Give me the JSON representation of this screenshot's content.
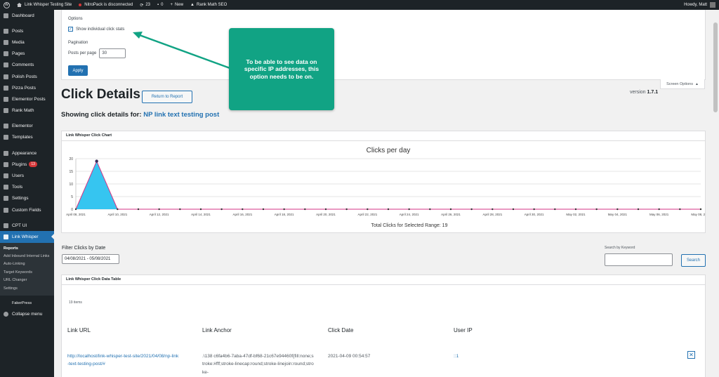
{
  "adminbar": {
    "site_name": "Link Whisper Testing Site",
    "nitropack": "NitroPack is disconnected",
    "updates": "23",
    "comments": "0",
    "new_label": "New",
    "rankmath": "Rank Math SEO",
    "howdy": "Howdy, Matt"
  },
  "sidebar": {
    "items": [
      {
        "label": "Dashboard",
        "icon": "dashboard-icon"
      },
      {
        "label": "Posts",
        "icon": "pin-icon"
      },
      {
        "label": "Media",
        "icon": "media-icon"
      },
      {
        "label": "Pages",
        "icon": "page-icon"
      },
      {
        "label": "Comments",
        "icon": "comment-icon"
      },
      {
        "label": "Polish Posts",
        "icon": "pin-icon"
      },
      {
        "label": "Pizza Posts",
        "icon": "pin-icon"
      },
      {
        "label": "Elementor Posts",
        "icon": "pin-icon"
      },
      {
        "label": "Rank Math",
        "icon": "chart-icon"
      },
      {
        "label": "Elementor",
        "icon": "elementor-icon"
      },
      {
        "label": "Templates",
        "icon": "folder-icon"
      },
      {
        "label": "Appearance",
        "icon": "brush-icon"
      },
      {
        "label": "Plugins",
        "icon": "plugin-icon",
        "badge": "13"
      },
      {
        "label": "Users",
        "icon": "user-icon"
      },
      {
        "label": "Tools",
        "icon": "wrench-icon"
      },
      {
        "label": "Settings",
        "icon": "settings-icon"
      },
      {
        "label": "Custom Fields",
        "icon": "grid-icon"
      },
      {
        "label": "CPT UI",
        "icon": "cpt-icon"
      },
      {
        "label": "Link Whisper",
        "icon": "link-icon"
      }
    ],
    "submenu": [
      "Reports",
      "Add Inbound Internal Links",
      "Auto-Linking",
      "Target Keywords",
      "URL Changer",
      "Settings"
    ],
    "faker": "FakerPress",
    "collapse": "Collapse menu"
  },
  "screen_options": {
    "options_heading": "Options",
    "checkbox_label": "Show individual click stats",
    "pagination_heading": "Pagination",
    "per_page_label": "Posts per page",
    "per_page_value": "30",
    "apply": "Apply",
    "tab_label": "Screen Options"
  },
  "header": {
    "title": "Click Details",
    "return_button": "Return to Report",
    "version_label": "version",
    "version": "1.7.1",
    "showing_label": "Showing click details for:",
    "post_title": "NP link text testing post"
  },
  "annotation": {
    "text": "To be able to see data on specific IP addresses, this option needs to be on."
  },
  "chart_box": {
    "title": "Link Whisper Click Chart"
  },
  "chart_data": {
    "type": "area",
    "title": "Clicks per day",
    "xlabel": "",
    "ylabel": "",
    "ylim": [
      0,
      20
    ],
    "yticks": [
      0,
      5,
      10,
      15,
      20
    ],
    "grid": true,
    "legend": "none",
    "tick_labels": [
      "April 08, 2021",
      "April 10, 2021",
      "April 12, 2021",
      "April 14, 2021",
      "April 16, 2021",
      "April 18, 2021",
      "April 20, 2021",
      "April 22, 2021",
      "April 24, 2021",
      "April 26, 2021",
      "April 28, 2021",
      "April 30, 2021",
      "May 02, 2021",
      "May 04, 2021",
      "May 06, 2021",
      "May 08, 2021"
    ],
    "x": [
      "2021-04-08",
      "2021-04-09",
      "2021-04-10",
      "2021-04-11",
      "2021-04-12",
      "2021-04-13",
      "2021-04-14",
      "2021-04-15",
      "2021-04-16",
      "2021-04-17",
      "2021-04-18",
      "2021-04-19",
      "2021-04-20",
      "2021-04-21",
      "2021-04-22",
      "2021-04-23",
      "2021-04-24",
      "2021-04-25",
      "2021-04-26",
      "2021-04-27",
      "2021-04-28",
      "2021-04-29",
      "2021-04-30",
      "2021-05-01",
      "2021-05-02",
      "2021-05-03",
      "2021-05-04",
      "2021-05-05",
      "2021-05-06",
      "2021-05-07",
      "2021-05-08"
    ],
    "values": [
      0,
      19,
      0,
      0,
      0,
      0,
      0,
      0,
      0,
      0,
      0,
      0,
      0,
      0,
      0,
      0,
      0,
      0,
      0,
      0,
      0,
      0,
      0,
      0,
      0,
      0,
      0,
      0,
      0,
      0,
      0
    ],
    "fill_color": "#36c5f0",
    "stroke_color": "#d63384",
    "footer": "Total Clicks for Selected Range: 19"
  },
  "filters": {
    "date_label": "Filter Clicks by Date",
    "date_value": "04/08/2021 - 05/08/2021",
    "keyword_label": "Search by Keyword",
    "keyword_value": "",
    "search_button": "Search"
  },
  "table": {
    "title": "Link Whisper Click Data Table",
    "items_count": "19 items",
    "headers": [
      "Link URL",
      "Link Anchor",
      "Click Date",
      "User IP"
    ],
    "rows": [
      {
        "url": "http://localhost/link-whisper-test-site/2021/04/08/np-link-text-testing-post/#",
        "anchor": ".\\138 c6fa4b6-7aba-47df-bf68-21c67e94460f{fill:none;stroke:#fff;stroke-linecap:round;stroke-linejoin:round;stroke-",
        "date": "2021-04-09 00:54:57",
        "ip": "::1",
        "delete": "✕"
      }
    ]
  }
}
